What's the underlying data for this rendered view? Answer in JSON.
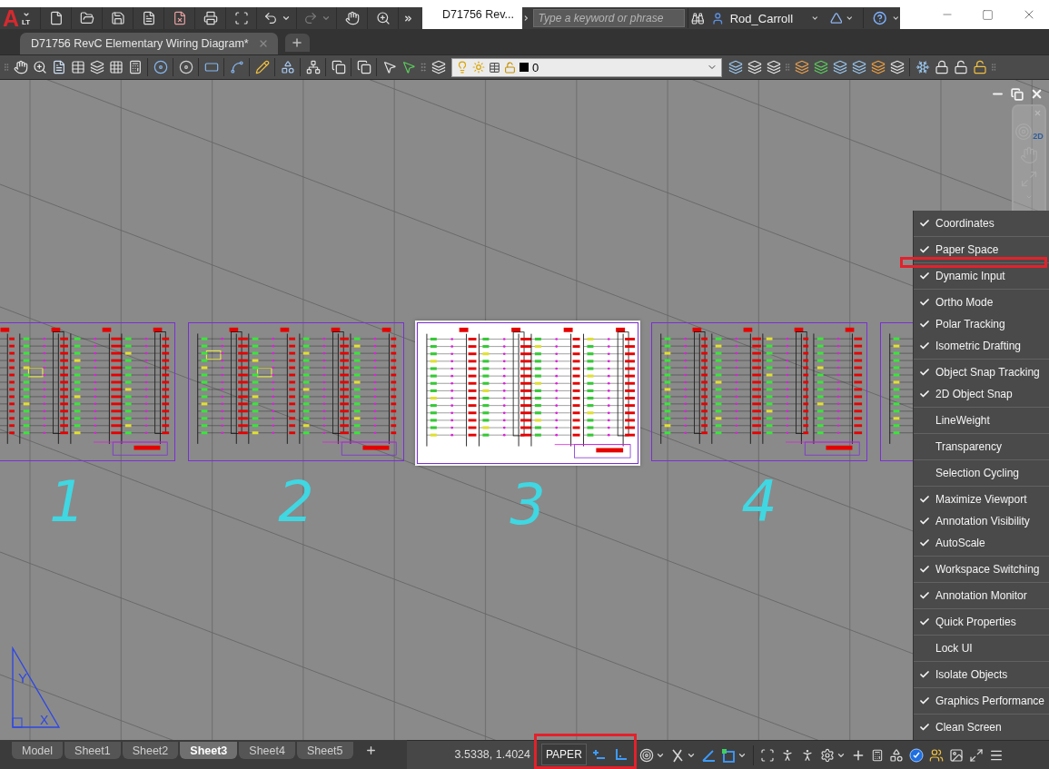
{
  "app_menu": {
    "logo": "A",
    "edition": "LT"
  },
  "quick_access_toolbar": {
    "redo_disabled": true
  },
  "window": {
    "title": "D71756 Rev..."
  },
  "search": {
    "placeholder": "Type a keyword or phrase"
  },
  "account": {
    "user_name": "Rod_Carroll"
  },
  "document_tabs": [
    {
      "label": "D71756 RevC Elementary Wiring Diagram*",
      "selected": true
    }
  ],
  "layer_control": {
    "current_layer": "0"
  },
  "viewports": [
    {
      "label": "1",
      "selected": false
    },
    {
      "label": "2",
      "selected": false
    },
    {
      "label": "3",
      "selected": true
    },
    {
      "label": "4",
      "selected": false
    },
    {
      "selected": false
    }
  ],
  "navigation_bar": {
    "wheel_label": "2D"
  },
  "ucs_icon": {
    "y_axis": "Y",
    "x_axis": "X"
  },
  "status_bar_customization_menu": {
    "groups": [
      {
        "items": [
          {
            "label": "Coordinates",
            "checked": true
          }
        ],
        "highlighted_divider": false
      },
      {
        "items": [
          {
            "label": "Paper Space",
            "checked": true
          }
        ],
        "highlighted_divider": true
      },
      {
        "items": [
          {
            "label": "Dynamic Input",
            "checked": true
          }
        ],
        "highlighted_divider": false
      },
      {
        "items": [
          {
            "label": "Ortho Mode",
            "checked": true
          },
          {
            "label": "Polar Tracking",
            "checked": true
          },
          {
            "label": "Isometric Drafting",
            "checked": true
          }
        ],
        "highlighted_divider": false
      },
      {
        "items": [
          {
            "label": "Object Snap Tracking",
            "checked": true
          },
          {
            "label": "2D Object Snap",
            "checked": true
          }
        ],
        "highlighted_divider": false
      },
      {
        "items": [
          {
            "label": "LineWeight",
            "checked": false
          }
        ],
        "highlighted_divider": false
      },
      {
        "items": [
          {
            "label": "Transparency",
            "checked": false
          }
        ],
        "highlighted_divider": false
      },
      {
        "items": [
          {
            "label": "Selection Cycling",
            "checked": false
          }
        ],
        "highlighted_divider": false
      },
      {
        "items": [
          {
            "label": "Maximize Viewport",
            "checked": true
          },
          {
            "label": "Annotation Visibility",
            "checked": true
          },
          {
            "label": "AutoScale",
            "checked": true
          }
        ],
        "highlighted_divider": false
      },
      {
        "items": [
          {
            "label": "Workspace Switching",
            "checked": true
          }
        ],
        "highlighted_divider": false
      },
      {
        "items": [
          {
            "label": "Annotation Monitor",
            "checked": true
          }
        ],
        "highlighted_divider": false
      },
      {
        "items": [
          {
            "label": "Quick Properties",
            "checked": true
          }
        ],
        "highlighted_divider": false
      },
      {
        "items": [
          {
            "label": "Lock UI",
            "checked": false
          }
        ],
        "highlighted_divider": false
      },
      {
        "items": [
          {
            "label": "Isolate Objects",
            "checked": true
          }
        ],
        "highlighted_divider": false
      },
      {
        "items": [
          {
            "label": "Graphics Performance",
            "checked": true
          }
        ],
        "highlighted_divider": false
      },
      {
        "items": [
          {
            "label": "Clean Screen",
            "checked": true
          }
        ],
        "highlighted_divider": false
      }
    ]
  },
  "layout_tabs": [
    {
      "label": "Model",
      "selected": false
    },
    {
      "label": "Sheet1",
      "selected": false
    },
    {
      "label": "Sheet2",
      "selected": false
    },
    {
      "label": "Sheet3",
      "selected": true
    },
    {
      "label": "Sheet4",
      "selected": false
    },
    {
      "label": "Sheet5",
      "selected": false
    }
  ],
  "status_bar": {
    "coordinates": "3.5338, 1.4024",
    "space_toggle": "PAPER",
    "highlighted": true
  }
}
